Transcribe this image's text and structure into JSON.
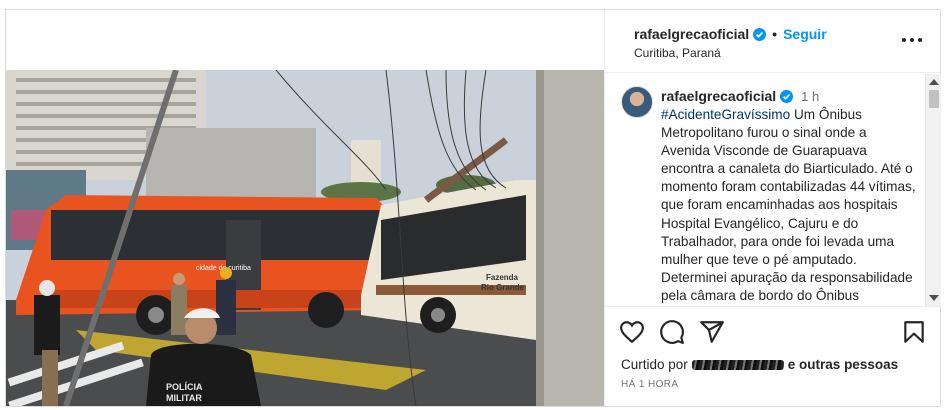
{
  "header": {
    "username": "rafaelgrecaoficial",
    "separator": "•",
    "follow_label": "Seguir",
    "location": "Curitiba, Paraná"
  },
  "caption": {
    "username": "rafaelgrecaoficial",
    "time": "1 h",
    "hashtag": "#AcidenteGravíssimo",
    "text": " Um Ônibus Metropolitano furou o sinal onde a Avenida Visconde de Guarapuava encontra a canaleta do Biarticulado. Até o momento foram contabilizadas 44 vítimas, que foram encaminhadas aos hospitais Hospital Evangélico, Cajuru e do Trabalhador, para onde foi levada uma mulher que teve o pé amputado. Determinei apuração da responsabilidade pela câmara de bordo do Ônibus Metropolitano e irei acompanhar"
  },
  "photo": {
    "bus_left_text": "cidade de curitiba",
    "bus_right_text_1": "Fazenda",
    "bus_right_text_2": "Rio Grande",
    "police_text_1": "POLÍCIA",
    "police_text_2": "MILITAR"
  },
  "actions": {
    "liked_by_prefix": "Curtido por",
    "liked_by_suffix": "e outras pessoas",
    "time_ago": "HÁ 1 HORA"
  },
  "icons": [
    "verified-badge-icon",
    "more-options-icon",
    "heart-icon",
    "comment-icon",
    "share-icon",
    "bookmark-icon"
  ],
  "colors": {
    "link_blue": "#0095f6",
    "hashtag": "#00376b",
    "verified": "#0095f6",
    "bus_orange": "#e8531f",
    "bus_cream": "#ece6d6"
  }
}
